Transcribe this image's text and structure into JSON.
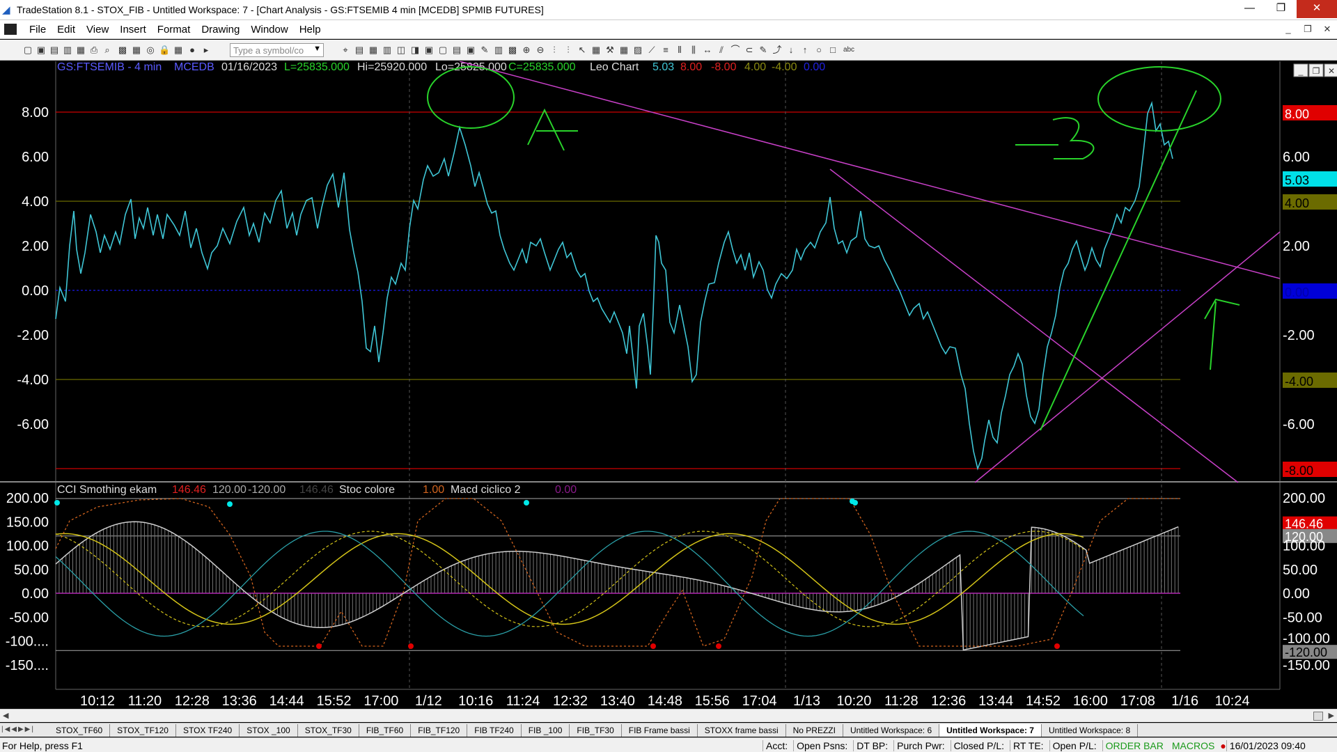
{
  "window": {
    "title": "TradeStation 8.1 - STOX_FIB - Untitled Workspace:  7 - [Chart Analysis - GS:FTSEMIB  4 min  [MCEDB] SPMIB FUTURES]",
    "minimize": "—",
    "maximize": "❐",
    "close": "✕"
  },
  "menu": {
    "items": [
      "File",
      "Edit",
      "View",
      "Insert",
      "Format",
      "Drawing",
      "Window",
      "Help"
    ],
    "mdi": [
      "_",
      "❐",
      "✕"
    ]
  },
  "toolbar": {
    "symbol_placeholder": "Type a symbol/co",
    "icons": [
      "new-icon",
      "open-icon",
      "save-icon",
      "copy-icon",
      "save-all-icon",
      "print-icon",
      "print-preview-icon",
      "chart-icon",
      "grid-icon",
      "radar-icon",
      "lock-icon",
      "matrix-icon",
      "globe-icon",
      "symbol-go-icon",
      "find-icon",
      "format-icon",
      "table-icon",
      "insert-icon",
      "indicator-icon",
      "strategy-icon",
      "window-icon",
      "window2-icon",
      "workspace-icon",
      "window3-icon",
      "brush-icon",
      "chart2-icon",
      "chart3-icon",
      "zoom-in-icon",
      "zoom-out-icon",
      "bars-icon",
      "bars2-icon",
      "cursor-icon",
      "data-window-icon",
      "hammer-icon",
      "order-icon",
      "drawing-icon",
      "trendline-icon",
      "hline-icon",
      "vline-icon",
      "fib-icon",
      "arrow-icon",
      "channel-icon",
      "arc-icon",
      "ellipse-icon",
      "pencil-icon",
      "curve-icon",
      "down-arrow-icon",
      "up-arrow-icon",
      "circle-icon",
      "rectangle-icon",
      "text-icon"
    ]
  },
  "colors": {
    "price": "#3fc6d6",
    "trendline_magenta": "#c840c8",
    "annotation_green": "#29d42b",
    "red_line": "#cc0000",
    "olive_line": "#6b6b00",
    "zero_line": "#1414c8",
    "yellow": "#d4c418",
    "orange": "#d2641e",
    "white_cci": "#cfcfcf",
    "teal_macd": "#2aa0a8"
  },
  "chart": {
    "header": {
      "symbol": "GS:FTSEMIB - 4 min",
      "source": "MCEDB",
      "date": "01/16/2023",
      "low_close": "L=25835.000",
      "high": "Hi=25920.000",
      "low": "Lo=25825.000",
      "close": "C=25835.000",
      "study": "Leo Chart",
      "v1": "5.03",
      "v2": "8.00",
      "v3": "-8.00",
      "v4": "4.00",
      "v5": "-4.00",
      "v6": "0.00"
    },
    "upper_axis": [
      "8.00",
      "6.00",
      "4.00",
      "2.00",
      "0.00",
      "-2.00",
      "-4.00",
      "-6.00"
    ],
    "upper_right_labels": {
      "r8": "8.00",
      "r6": "6.00",
      "last": "5.03",
      "r4": "4.00",
      "r2": "2.00",
      "r0": "0.00",
      "rm2": "-2.00",
      "rm4": "-4.00",
      "rm6": "-6.00",
      "rm8": "-8.00"
    },
    "lower_header": {
      "cci": "CCI Smothing ekam",
      "cci_v1": "146.46",
      "cci_v2": "120.00",
      "cci_v3": "-120.00",
      "cci_v4": "146.46",
      "stoc": "Stoc colore",
      "stoc_v": "1.00",
      "macd": "Macd ciclico 2",
      "macd_v": "0.00"
    },
    "lower_axis": [
      "200.00",
      "150.00",
      "100.00",
      "50.00",
      "0.00",
      "-50.00",
      "-100....",
      "-150...."
    ],
    "lower_right_labels": {
      "r200": "200.00",
      "last": "146.46",
      "r120": "120.00",
      "r100": "100.00",
      "r50": "50.00",
      "r0": "0.00",
      "rm50": "-50.00",
      "rm100": "-100.00",
      "rm120": "-120.00",
      "rm150": "-150.00"
    },
    "time_axis": [
      "10:12",
      "11:20",
      "12:28",
      "13:36",
      "14:44",
      "15:52",
      "17:00",
      "1/12",
      "10:16",
      "11:24",
      "12:32",
      "13:40",
      "14:48",
      "15:56",
      "17:04",
      "1/13",
      "10:20",
      "11:28",
      "12:36",
      "13:44",
      "14:52",
      "16:00",
      "17:08",
      "1/16",
      "10:24"
    ],
    "annotations": {
      "a": "A",
      "b": "B"
    },
    "pane_btns": [
      "_",
      "❐",
      "✕"
    ]
  },
  "tabs": {
    "items": [
      "STOX_TF60",
      "STOX_TF120",
      "STOX TF240",
      "STOX _100",
      "STOX_TF30",
      "FIB_TF60",
      "FIB_TF120",
      "FIB TF240",
      "FIB _100",
      "FIB_TF30",
      "FIB Frame bassi",
      "STOXX frame bassi",
      "No PREZZI",
      "Untitled Workspace:  6",
      "Untitled Workspace:  7",
      "Untitled Workspace:  8"
    ],
    "active_index": 14
  },
  "status": {
    "help": "For Help, press F1",
    "acct": "Acct:",
    "open_psns": "Open Psns:",
    "dt_bp": "DT BP:",
    "purch_pwr": "Purch Pwr:",
    "closed_pl": "Closed P/L:",
    "rt_te": "RT TE:",
    "open_pl": "Open P/L:",
    "order_bar": "ORDER BAR",
    "macros": "MACROS",
    "datetime": "16/01/2023 09:40"
  }
}
